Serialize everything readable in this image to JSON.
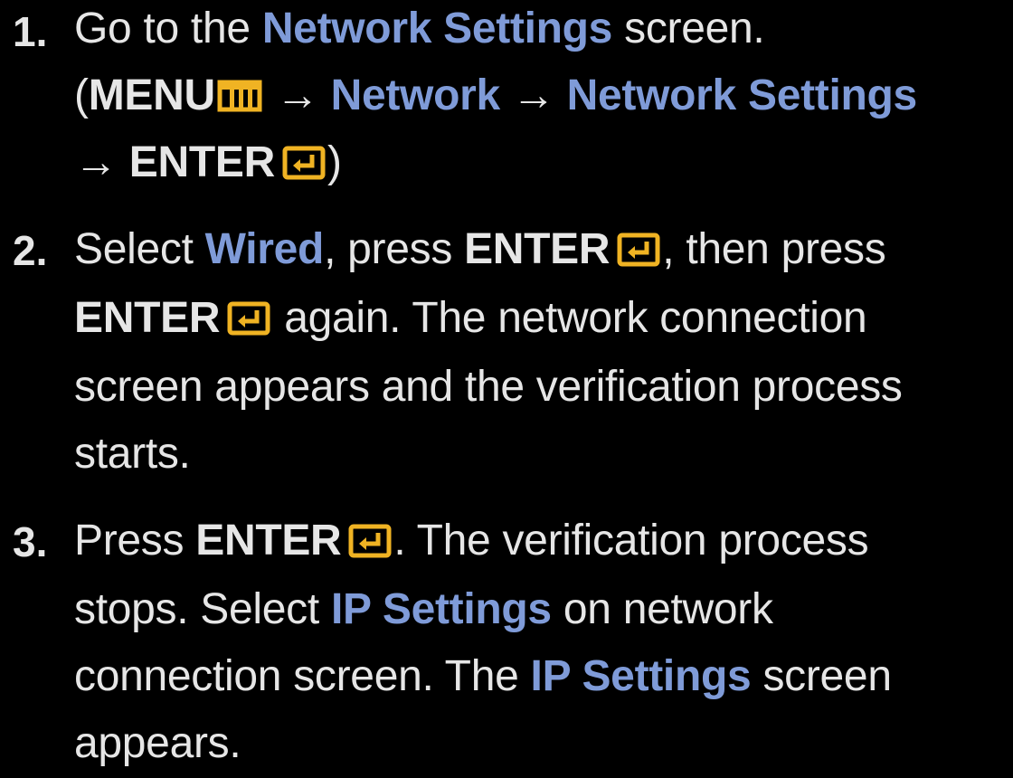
{
  "colors": {
    "background": "#000000",
    "text": "#e6e6e6",
    "highlight": "#7f9bd8",
    "icon": "#f0b323"
  },
  "steps": [
    {
      "number": "1.",
      "line1": {
        "a": "Go to the ",
        "hl": "Network Settings",
        "b": " screen."
      },
      "line2": {
        "open": "(",
        "menu": "MENU",
        "arrow1": " → ",
        "hl1": "Network",
        "arrow2": " → ",
        "hl2": "Network Settings"
      },
      "line3": {
        "arrow": "→ ",
        "enter": "ENTER",
        "close": ")"
      }
    },
    {
      "number": "2.",
      "line1": {
        "a": "Select ",
        "hl": "Wired",
        "b": ", press ",
        "enter": "ENTER",
        "c": ", then press"
      },
      "line2": {
        "enter": "ENTER",
        "a": " again. The network connection"
      },
      "line3": "screen appears and the verification process",
      "line4": "starts."
    },
    {
      "number": "3.",
      "line1": {
        "a": "Press ",
        "enter": "ENTER",
        "b": ". The verification process"
      },
      "line2": {
        "a": "stops. Select ",
        "hl": "IP Settings",
        "b": " on network"
      },
      "line3": {
        "a": "connection screen. The ",
        "hl": "IP Settings",
        "b": " screen"
      },
      "line4": "appears."
    }
  ],
  "icons": {
    "menu": "menu-icon",
    "enter": "enter-icon"
  }
}
